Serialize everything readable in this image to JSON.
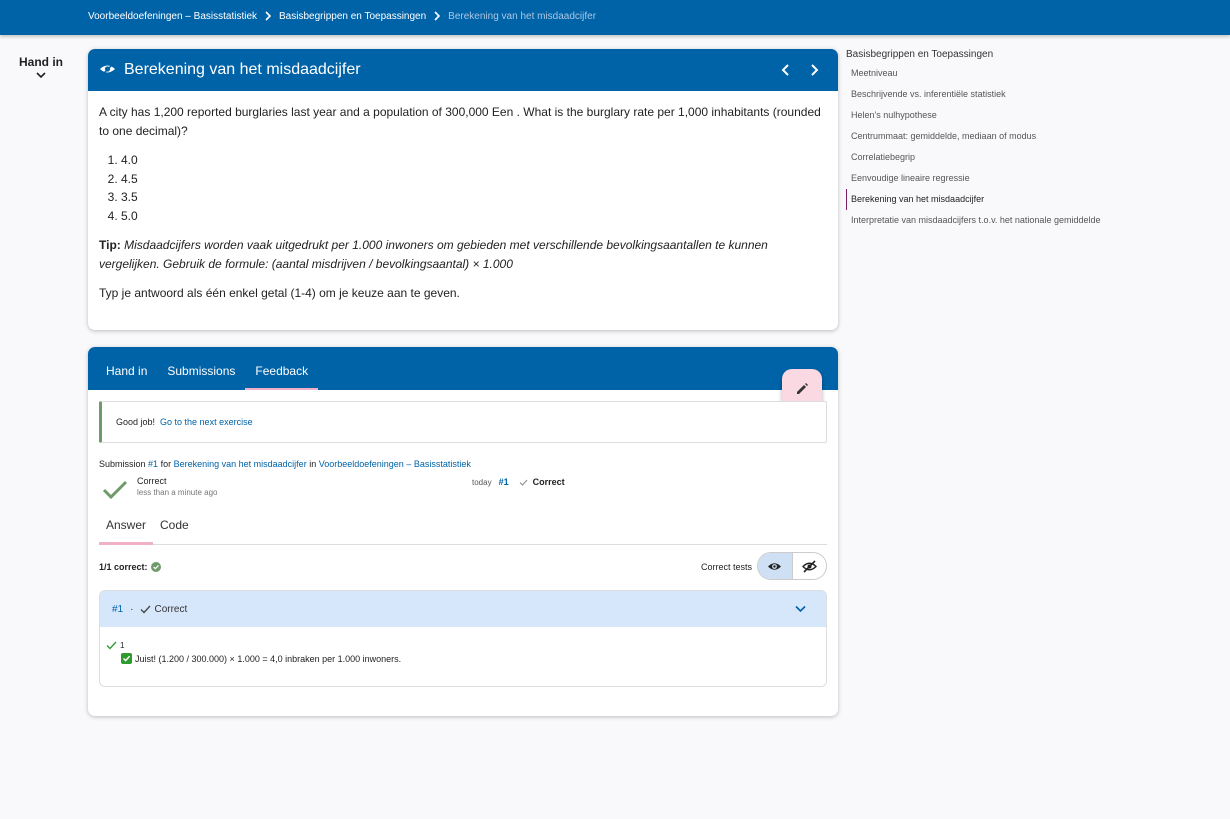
{
  "breadcrumb": {
    "items": [
      "Voorbeeldoefeningen – Basisstatistiek",
      "Basisbegrippen en Toepassingen"
    ],
    "current": "Berekening van het misdaadcijfer"
  },
  "side_handin": {
    "label": "Hand in"
  },
  "exercise": {
    "title": "Berekening van het misdaadcijfer",
    "question": "A city has 1,200 reported burglaries last year and a population of 300,000 Een . What is the burglary rate per 1,000 inhabitants (rounded to one decimal)?",
    "options": [
      "4.0",
      "4.5",
      "3.5",
      "5.0"
    ],
    "tip_label": "Tip:",
    "tip_text": "Misdaadcijfers worden vaak uitgedrukt per 1.000 inwoners om gebieden met verschillende bevolkingsaantallen te kunnen vergelijken. Gebruik de formule: (aantal misdrijven / bevolkingsaantal) × 1.000",
    "instruction": "Typ je antwoord als één enkel getal (1-4) om je keuze aan te geven."
  },
  "feedback": {
    "tabs": [
      "Hand in",
      "Submissions",
      "Feedback"
    ],
    "active_tab": "Feedback",
    "alert_text": "Good job!",
    "alert_link": "Go to the next exercise",
    "submission": {
      "prefix": "Submission",
      "number": "#1",
      "for_word": "for",
      "exercise_link": "Berekening van het misdaadcijfer",
      "in_word": "in",
      "course_link": "Voorbeeldoefeningen – Basisstatistiek",
      "status": "Correct",
      "time_ago": "less than a minute ago",
      "date": "today",
      "meta_number": "#1",
      "meta_status": "Correct"
    },
    "sub_tabs": [
      "Answer",
      "Code"
    ],
    "active_sub_tab": "Answer",
    "count_text": "1/1 correct:",
    "correct_tests_label": "Correct tests",
    "test": {
      "number": "#1",
      "separator": "·",
      "status": "Correct",
      "input": "1",
      "message": "Juist! (1.200 / 300.000) × 1.000 = 4,0 inbraken per 1.000 inwoners."
    }
  },
  "side_nav": {
    "heading": "Basisbegrippen en Toepassingen",
    "items": [
      "Meetniveau",
      "Beschrijvende vs. inferentiële statistiek",
      "Helen's nulhypothese",
      "Centrummaat: gemiddelde, mediaan of modus",
      "Correlatiebegrip",
      "Eenvoudige lineaire regressie",
      "Berekening van het misdaadcijfer",
      "Interpretatie van misdaadcijfers t.o.v. het nationale gemiddelde"
    ],
    "active_index": 6
  },
  "colors": {
    "primary": "#0063a8",
    "success": "#2e9b2e",
    "accent_pink": "#f0b0c8",
    "test_header": "#d6e6fb"
  }
}
